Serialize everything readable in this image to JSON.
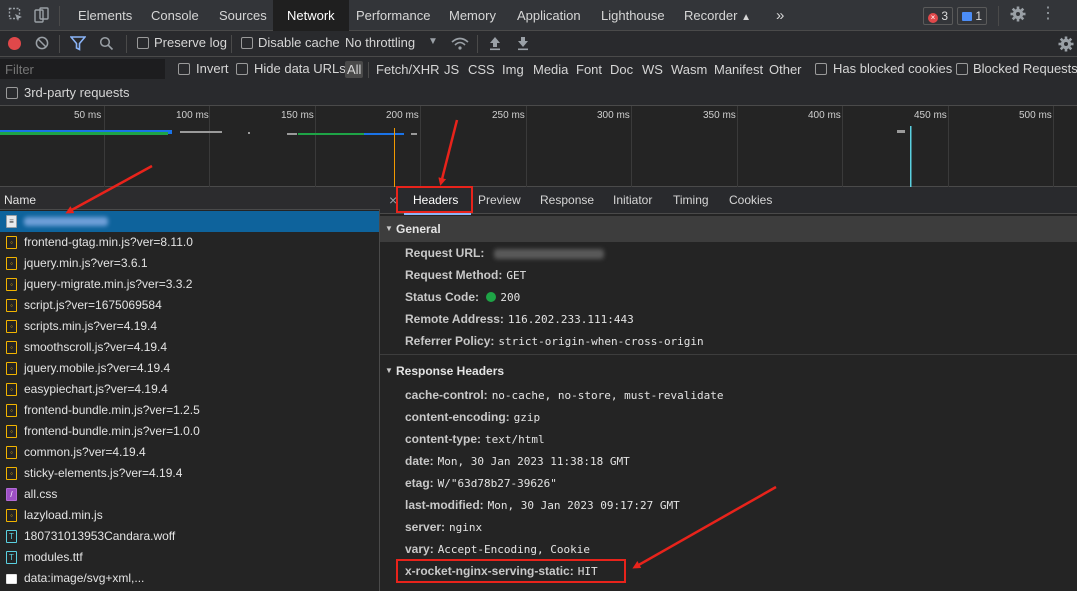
{
  "topbar": {
    "tabs": [
      "Elements",
      "Console",
      "Sources",
      "Network",
      "Performance",
      "Memory",
      "Application",
      "Lighthouse",
      "Recorder"
    ],
    "active_tab": "Network",
    "more_label": "»",
    "errors_count": "3",
    "messages_count": "1"
  },
  "toolbar": {
    "preserve_log": "Preserve log",
    "disable_cache": "Disable cache",
    "throttling": "No throttling"
  },
  "filter": {
    "placeholder": "Filter",
    "invert": "Invert",
    "hide_data_urls": "Hide data URLs",
    "types": [
      "All",
      "Fetch/XHR",
      "JS",
      "CSS",
      "Img",
      "Media",
      "Font",
      "Doc",
      "WS",
      "Wasm",
      "Manifest",
      "Other"
    ],
    "blocked_cookies": "Has blocked cookies",
    "blocked_requests": "Blocked Requests",
    "third_party": "3rd-party requests"
  },
  "overview": {
    "ticks": [
      "50 ms",
      "100 ms",
      "150 ms",
      "200 ms",
      "250 ms",
      "300 ms",
      "350 ms",
      "400 ms",
      "450 ms",
      "500 ms"
    ]
  },
  "requests": {
    "header": "Name",
    "rows": [
      {
        "name": "",
        "type": "doc",
        "selected": true
      },
      {
        "name": "frontend-gtag.min.js?ver=8.11.0",
        "type": "js"
      },
      {
        "name": "jquery.min.js?ver=3.6.1",
        "type": "js"
      },
      {
        "name": "jquery-migrate.min.js?ver=3.3.2",
        "type": "js"
      },
      {
        "name": "script.js?ver=1675069584",
        "type": "js"
      },
      {
        "name": "scripts.min.js?ver=4.19.4",
        "type": "js"
      },
      {
        "name": "smoothscroll.js?ver=4.19.4",
        "type": "js"
      },
      {
        "name": "jquery.mobile.js?ver=4.19.4",
        "type": "js"
      },
      {
        "name": "easypiechart.js?ver=4.19.4",
        "type": "js"
      },
      {
        "name": "frontend-bundle.min.js?ver=1.2.5",
        "type": "js"
      },
      {
        "name": "frontend-bundle.min.js?ver=1.0.0",
        "type": "js"
      },
      {
        "name": "common.js?ver=4.19.4",
        "type": "js"
      },
      {
        "name": "sticky-elements.js?ver=4.19.4",
        "type": "js"
      },
      {
        "name": "all.css",
        "type": "css"
      },
      {
        "name": "lazyload.min.js",
        "type": "js"
      },
      {
        "name": "180731013953Candara.woff",
        "type": "font"
      },
      {
        "name": "modules.ttf",
        "type": "font"
      },
      {
        "name": "data:image/svg+xml,...",
        "type": "img"
      }
    ]
  },
  "details": {
    "close": "×",
    "tabs": [
      "Headers",
      "Preview",
      "Response",
      "Initiator",
      "Timing",
      "Cookies"
    ],
    "active_tab": "Headers",
    "general": {
      "title": "General",
      "items": [
        {
          "key": "Request URL:",
          "value": ""
        },
        {
          "key": "Request Method:",
          "value": "GET"
        },
        {
          "key": "Status Code:",
          "value": "200"
        },
        {
          "key": "Remote Address:",
          "value": "116.202.233.111:443"
        },
        {
          "key": "Referrer Policy:",
          "value": "strict-origin-when-cross-origin"
        }
      ]
    },
    "response": {
      "title": "Response Headers",
      "items": [
        {
          "key": "cache-control:",
          "value": "no-cache, no-store, must-revalidate"
        },
        {
          "key": "content-encoding:",
          "value": "gzip"
        },
        {
          "key": "content-type:",
          "value": "text/html"
        },
        {
          "key": "date:",
          "value": "Mon, 30 Jan 2023 11:38:18 GMT"
        },
        {
          "key": "etag:",
          "value": "W/\"63d78b27-39626\""
        },
        {
          "key": "last-modified:",
          "value": "Mon, 30 Jan 2023 09:17:27 GMT"
        },
        {
          "key": "server:",
          "value": "nginx"
        },
        {
          "key": "vary:",
          "value": "Accept-Encoding, Cookie"
        },
        {
          "key": "x-rocket-nginx-serving-static:",
          "value": "HIT"
        }
      ]
    }
  },
  "colors": {
    "accent": "#8ab4f8",
    "selected_row": "#0e639c",
    "annotation_red": "#e8231b",
    "status_ok": "#1ea446",
    "record_red": "#e0484a"
  }
}
